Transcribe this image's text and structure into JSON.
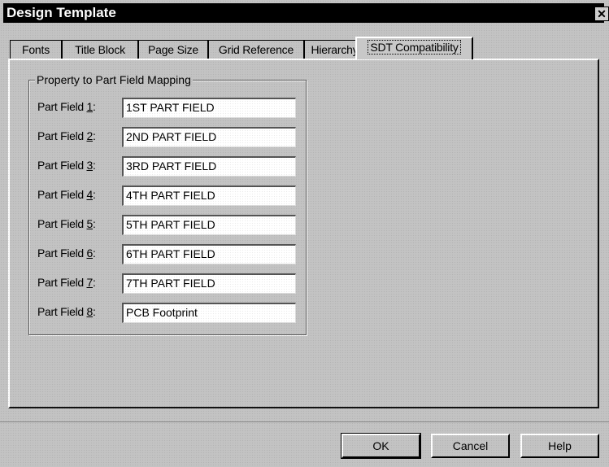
{
  "window": {
    "title": "Design Template",
    "close_glyph": "✕"
  },
  "tabs": [
    {
      "label": "Fonts"
    },
    {
      "label": "Title Block"
    },
    {
      "label": "Page Size"
    },
    {
      "label": "Grid Reference"
    },
    {
      "label": "Hierarchy"
    },
    {
      "label": "SDT Compatibility",
      "active": true
    }
  ],
  "group": {
    "title": "Property to Part Field Mapping",
    "fields": [
      {
        "label": "Part Field ",
        "key": "1",
        "value": "1ST PART FIELD"
      },
      {
        "label": "Part Field ",
        "key": "2",
        "value": "2ND PART FIELD"
      },
      {
        "label": "Part Field ",
        "key": "3",
        "value": "3RD PART FIELD"
      },
      {
        "label": "Part Field ",
        "key": "4",
        "value": "4TH PART FIELD"
      },
      {
        "label": "Part Field ",
        "key": "5",
        "value": "5TH PART FIELD"
      },
      {
        "label": "Part Field ",
        "key": "6",
        "value": "6TH PART FIELD"
      },
      {
        "label": "Part Field ",
        "key": "7",
        "value": "7TH PART FIELD"
      },
      {
        "label": "Part Field ",
        "key": "8",
        "value": "PCB Footprint"
      }
    ],
    "label_suffix": ":"
  },
  "buttons": {
    "ok": "OK",
    "cancel": "Cancel",
    "help": "Help"
  }
}
